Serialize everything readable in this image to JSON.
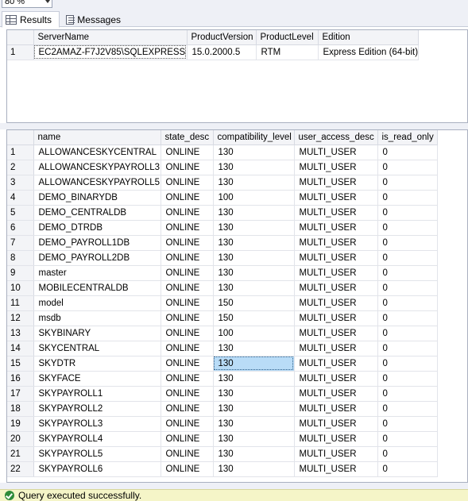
{
  "zoom": {
    "value": "80 %"
  },
  "tabs": [
    {
      "label": "Results",
      "icon": "grid-icon",
      "active": true
    },
    {
      "label": "Messages",
      "icon": "messages-icon",
      "active": false
    }
  ],
  "result1": {
    "columns": [
      "ServerName",
      "ProductVersion",
      "ProductLevel",
      "Edition"
    ],
    "rows": [
      [
        "1",
        "EC2AMAZ-F7J2V85\\SQLEXPRESS",
        "15.0.2000.5",
        "RTM",
        "Express Edition (64-bit)"
      ]
    ]
  },
  "result2": {
    "columns": [
      "name",
      "state_desc",
      "compatibility_level",
      "user_access_desc",
      "is_read_only"
    ],
    "rows": [
      [
        "1",
        "ALLOWANCESKYCENTRAL",
        "ONLINE",
        "130",
        "MULTI_USER",
        "0"
      ],
      [
        "2",
        "ALLOWANCESKYPAYROLL3",
        "ONLINE",
        "130",
        "MULTI_USER",
        "0"
      ],
      [
        "3",
        "ALLOWANCESKYPAYROLL5",
        "ONLINE",
        "130",
        "MULTI_USER",
        "0"
      ],
      [
        "4",
        "DEMO_BINARYDB",
        "ONLINE",
        "100",
        "MULTI_USER",
        "0"
      ],
      [
        "5",
        "DEMO_CENTRALDB",
        "ONLINE",
        "130",
        "MULTI_USER",
        "0"
      ],
      [
        "6",
        "DEMO_DTRDB",
        "ONLINE",
        "130",
        "MULTI_USER",
        "0"
      ],
      [
        "7",
        "DEMO_PAYROLL1DB",
        "ONLINE",
        "130",
        "MULTI_USER",
        "0"
      ],
      [
        "8",
        "DEMO_PAYROLL2DB",
        "ONLINE",
        "130",
        "MULTI_USER",
        "0"
      ],
      [
        "9",
        "master",
        "ONLINE",
        "130",
        "MULTI_USER",
        "0"
      ],
      [
        "10",
        "MOBILECENTRALDB",
        "ONLINE",
        "130",
        "MULTI_USER",
        "0"
      ],
      [
        "11",
        "model",
        "ONLINE",
        "150",
        "MULTI_USER",
        "0"
      ],
      [
        "12",
        "msdb",
        "ONLINE",
        "150",
        "MULTI_USER",
        "0"
      ],
      [
        "13",
        "SKYBINARY",
        "ONLINE",
        "100",
        "MULTI_USER",
        "0"
      ],
      [
        "14",
        "SKYCENTRAL",
        "ONLINE",
        "130",
        "MULTI_USER",
        "0"
      ],
      [
        "15",
        "SKYDTR",
        "ONLINE",
        "130",
        "MULTI_USER",
        "0"
      ],
      [
        "16",
        "SKYFACE",
        "ONLINE",
        "130",
        "MULTI_USER",
        "0"
      ],
      [
        "17",
        "SKYPAYROLL1",
        "ONLINE",
        "130",
        "MULTI_USER",
        "0"
      ],
      [
        "18",
        "SKYPAYROLL2",
        "ONLINE",
        "130",
        "MULTI_USER",
        "0"
      ],
      [
        "19",
        "SKYPAYROLL3",
        "ONLINE",
        "130",
        "MULTI_USER",
        "0"
      ],
      [
        "20",
        "SKYPAYROLL4",
        "ONLINE",
        "130",
        "MULTI_USER",
        "0"
      ],
      [
        "21",
        "SKYPAYROLL5",
        "ONLINE",
        "130",
        "MULTI_USER",
        "0"
      ],
      [
        "22",
        "SKYPAYROLL6",
        "ONLINE",
        "130",
        "MULTI_USER",
        "0"
      ]
    ],
    "selected": {
      "row": 15,
      "column": "compatibility_level"
    }
  },
  "status": {
    "text": "Query executed successfully.",
    "icon": "success-check-icon",
    "color": "#f5f5c8"
  }
}
